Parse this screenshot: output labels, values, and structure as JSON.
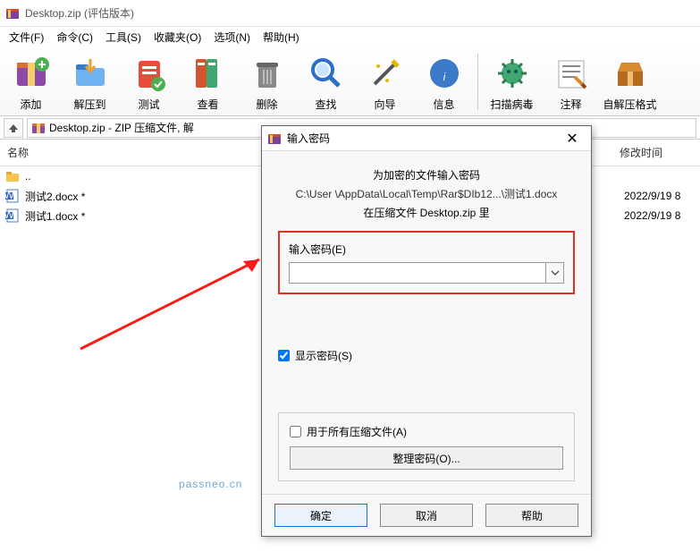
{
  "window": {
    "title": "Desktop.zip (评估版本)"
  },
  "menus": [
    "文件(F)",
    "命令(C)",
    "工具(S)",
    "收藏夹(O)",
    "选项(N)",
    "帮助(H)"
  ],
  "toolbar": [
    "添加",
    "解压到",
    "测试",
    "查看",
    "删除",
    "查找",
    "向导",
    "信息",
    "扫描病毒",
    "注释",
    "自解压格式"
  ],
  "pathbar": {
    "text": "Desktop.zip - ZIP 压缩文件, 解"
  },
  "columns": {
    "name": "名称",
    "mtime": "修改时间"
  },
  "files": [
    {
      "name": "..",
      "icon": "folder",
      "mtime": ""
    },
    {
      "name": "测试2.docx *",
      "icon": "docx",
      "mtime": "2022/9/19 8"
    },
    {
      "name": "测试1.docx *",
      "icon": "docx",
      "mtime": "2022/9/19 8"
    }
  ],
  "dialog": {
    "title": "输入密码",
    "heading": "为加密的文件输入密码",
    "path": "C:\\User                  \\AppData\\Local\\Temp\\Rar$DIb12...\\测试1.docx",
    "inArchive": "在压缩文件 Desktop.zip 里",
    "inputLabel": "输入密码(E)",
    "inputValue": "",
    "showPwd": "显示密码(S)",
    "showPwdChecked": true,
    "useAll": "用于所有压缩文件(A)",
    "useAllChecked": false,
    "organize": "整理密码(O)...",
    "ok": "确定",
    "cancel": "取消",
    "help": "帮助"
  },
  "watermark": "passneo.cn"
}
